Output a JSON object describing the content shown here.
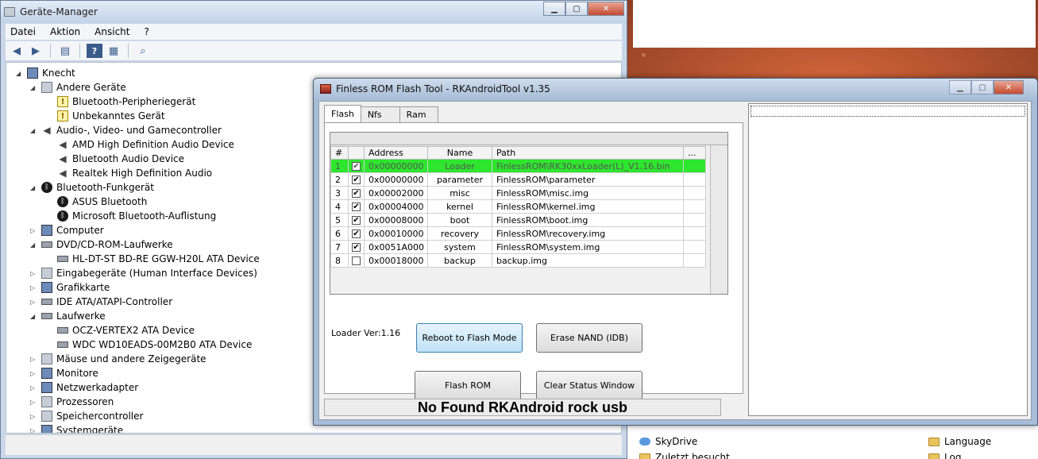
{
  "devmgr": {
    "title": "Geräte-Manager",
    "menu": [
      "Datei",
      "Aktion",
      "Ansicht",
      "?"
    ],
    "tree": [
      {
        "label": "Knecht",
        "level": 0,
        "exp": "open",
        "icon": "computer-icon"
      },
      {
        "label": "Andere Geräte",
        "level": 1,
        "exp": "open",
        "icon": "unknown-device-icon"
      },
      {
        "label": "Bluetooth-Peripheriegerät",
        "level": 2,
        "exp": "",
        "icon": "warning-device-icon"
      },
      {
        "label": "Unbekanntes Gerät",
        "level": 2,
        "exp": "",
        "icon": "warning-device-icon"
      },
      {
        "label": "Audio-, Video- und Gamecontroller",
        "level": 1,
        "exp": "open",
        "icon": "speaker-icon"
      },
      {
        "label": "AMD High Definition Audio Device",
        "level": 2,
        "exp": "",
        "icon": "speaker-icon"
      },
      {
        "label": "Bluetooth Audio Device",
        "level": 2,
        "exp": "",
        "icon": "speaker-icon"
      },
      {
        "label": "Realtek High Definition Audio",
        "level": 2,
        "exp": "",
        "icon": "speaker-icon"
      },
      {
        "label": "Bluetooth-Funkgerät",
        "level": 1,
        "exp": "open",
        "icon": "bluetooth-icon"
      },
      {
        "label": "ASUS Bluetooth",
        "level": 2,
        "exp": "",
        "icon": "bluetooth-icon"
      },
      {
        "label": "Microsoft Bluetooth-Auflistung",
        "level": 2,
        "exp": "",
        "icon": "bluetooth-icon"
      },
      {
        "label": "Computer",
        "level": 1,
        "exp": "closed",
        "icon": "monitor-icon"
      },
      {
        "label": "DVD/CD-ROM-Laufwerke",
        "level": 1,
        "exp": "open",
        "icon": "drive-icon"
      },
      {
        "label": "HL-DT-ST BD-RE  GGW-H20L ATA Device",
        "level": 2,
        "exp": "",
        "icon": "drive-icon"
      },
      {
        "label": "Eingabegeräte (Human Interface Devices)",
        "level": 1,
        "exp": "closed",
        "icon": "device-icon"
      },
      {
        "label": "Grafikkarte",
        "level": 1,
        "exp": "closed",
        "icon": "monitor-icon"
      },
      {
        "label": "IDE ATA/ATAPI-Controller",
        "level": 1,
        "exp": "closed",
        "icon": "drive-icon"
      },
      {
        "label": "Laufwerke",
        "level": 1,
        "exp": "open",
        "icon": "drive-icon"
      },
      {
        "label": "OCZ-VERTEX2 ATA Device",
        "level": 2,
        "exp": "",
        "icon": "drive-icon"
      },
      {
        "label": "WDC WD10EADS-00M2B0 ATA Device",
        "level": 2,
        "exp": "",
        "icon": "drive-icon"
      },
      {
        "label": "Mäuse und andere Zeigegeräte",
        "level": 1,
        "exp": "closed",
        "icon": "device-icon"
      },
      {
        "label": "Monitore",
        "level": 1,
        "exp": "closed",
        "icon": "monitor-icon"
      },
      {
        "label": "Netzwerkadapter",
        "level": 1,
        "exp": "closed",
        "icon": "monitor-icon"
      },
      {
        "label": "Prozessoren",
        "level": 1,
        "exp": "closed",
        "icon": "device-icon"
      },
      {
        "label": "Speichercontroller",
        "level": 1,
        "exp": "closed",
        "icon": "device-icon"
      },
      {
        "label": "Systemgeräte",
        "level": 1,
        "exp": "closed",
        "icon": "monitor-icon"
      }
    ]
  },
  "flash": {
    "title": "Finless ROM Flash Tool - RKAndroidTool v1.35",
    "tabs": [
      "Flash",
      "Nfs",
      "Ram"
    ],
    "columns": [
      "#",
      "",
      "Address",
      "Name",
      "Path",
      "..."
    ],
    "rows": [
      {
        "n": "1",
        "checked": true,
        "address": "0x00000000",
        "name": "Loader",
        "path": "FinlessROM\\RK30xxLoader(L)_V1.16.bin",
        "highlight": true
      },
      {
        "n": "2",
        "checked": true,
        "address": "0x00000000",
        "name": "parameter",
        "path": "FinlessROM\\parameter",
        "highlight": false
      },
      {
        "n": "3",
        "checked": true,
        "address": "0x00002000",
        "name": "misc",
        "path": "FinlessROM\\misc.img",
        "highlight": false
      },
      {
        "n": "4",
        "checked": true,
        "address": "0x00004000",
        "name": "kernel",
        "path": "FinlessROM\\kernel.img",
        "highlight": false
      },
      {
        "n": "5",
        "checked": true,
        "address": "0x00008000",
        "name": "boot",
        "path": "FinlessROM\\boot.img",
        "highlight": false
      },
      {
        "n": "6",
        "checked": true,
        "address": "0x00010000",
        "name": "recovery",
        "path": "FinlessROM\\recovery.img",
        "highlight": false
      },
      {
        "n": "7",
        "checked": true,
        "address": "0x0051A000",
        "name": "system",
        "path": "FinlessROM\\system.img",
        "highlight": false
      },
      {
        "n": "8",
        "checked": false,
        "address": "0x00018000",
        "name": "backup",
        "path": "backup.img",
        "highlight": false
      }
    ],
    "loader_ver": "Loader Ver:1.16",
    "buttons": {
      "reboot": "Reboot to Flash Mode",
      "erase": "Erase NAND (IDB)",
      "flash": "Flash ROM",
      "clear": "Clear Status Window"
    },
    "status": "No Found RKAndroid rock usb"
  },
  "explorer": {
    "left_items": [
      "SkyDrive",
      "Zuletzt besucht"
    ],
    "right_items": [
      "Language",
      "Log"
    ]
  }
}
